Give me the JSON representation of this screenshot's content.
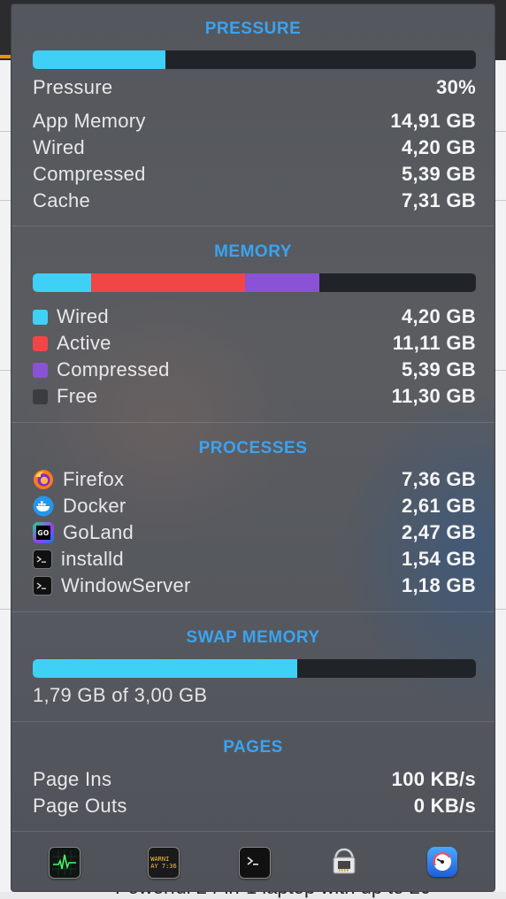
{
  "background": {
    "footer_text": "Powerful 24-in-1 laptop with up to 20"
  },
  "pressure": {
    "title": "PRESSURE",
    "level": 0.3,
    "rows": [
      {
        "label": "Pressure",
        "value": "30%"
      },
      {
        "label": "App Memory",
        "value": "14,91 GB"
      },
      {
        "label": "Wired",
        "value": "4,20 GB"
      },
      {
        "label": "Compressed",
        "value": "5,39 GB"
      },
      {
        "label": "Cache",
        "value": "7,31 GB"
      }
    ]
  },
  "memory": {
    "title": "MEMORY",
    "segments": [
      {
        "label": "Wired",
        "value": "4,20 GB",
        "gb": 4.2,
        "color": "#3fd0f6"
      },
      {
        "label": "Active",
        "value": "11,11 GB",
        "gb": 11.11,
        "color": "#f24545"
      },
      {
        "label": "Compressed",
        "value": "5,39 GB",
        "gb": 5.39,
        "color": "#8a52d4"
      },
      {
        "label": "Free",
        "value": "11,30 GB",
        "gb": 11.3,
        "color": "#3a3c40"
      }
    ]
  },
  "processes": {
    "title": "PROCESSES",
    "items": [
      {
        "name": "Firefox",
        "value": "7,36 GB",
        "icon": "firefox-icon"
      },
      {
        "name": "Docker",
        "value": "2,61 GB",
        "icon": "docker-icon"
      },
      {
        "name": "GoLand",
        "value": "2,47 GB",
        "icon": "goland-icon"
      },
      {
        "name": "installd",
        "value": "1,54 GB",
        "icon": "terminal-icon"
      },
      {
        "name": "WindowServer",
        "value": "1,18 GB",
        "icon": "terminal-icon"
      }
    ]
  },
  "swap": {
    "title": "SWAP MEMORY",
    "level": 0.597,
    "label": "1,79 GB of 3,00 GB"
  },
  "pages": {
    "title": "PAGES",
    "rows": [
      {
        "label": "Page Ins",
        "value": "100 KB/s"
      },
      {
        "label": "Page Outs",
        "value": "0 KB/s"
      }
    ]
  },
  "toolbar": {
    "console_text": "WARNI\nAY 7:36",
    "items": [
      {
        "name": "activity-monitor-icon"
      },
      {
        "name": "console-icon"
      },
      {
        "name": "terminal-icon"
      },
      {
        "name": "system-information-icon"
      },
      {
        "name": "istat-menus-icon"
      }
    ]
  },
  "colors": {
    "accent": "#3aa3f2",
    "pressure_fill": "#3fd0f6",
    "swap_fill": "#3fd0f6"
  }
}
